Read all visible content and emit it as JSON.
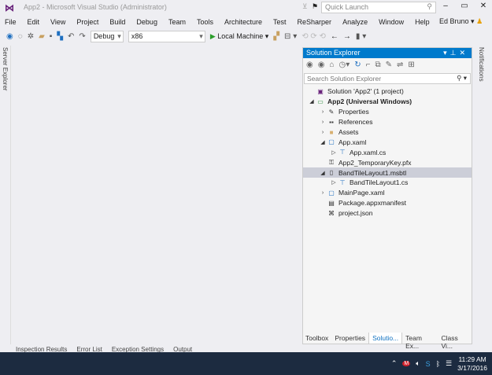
{
  "window": {
    "title": "App2 - Microsoft Visual Studio (Administrator)",
    "quick_launch_placeholder": "Quick Launch",
    "user": "Ed Bruno"
  },
  "menu": [
    "File",
    "Edit",
    "View",
    "Project",
    "Build",
    "Debug",
    "Team",
    "Tools",
    "Architecture",
    "Test",
    "ReSharper",
    "Analyze",
    "Window",
    "Help"
  ],
  "toolbar": {
    "configuration": "Debug",
    "platform": "x86",
    "run_target": "Local Machine"
  },
  "left_strip": {
    "label": "Server Explorer"
  },
  "right_strip": {
    "label": "Notifications"
  },
  "solution_explorer": {
    "title": "Solution Explorer",
    "search_placeholder": "Search Solution Explorer",
    "items": [
      {
        "label": "Solution 'App2' (1 project)",
        "indent": 0,
        "arrow": "",
        "icon": "solution-icon"
      },
      {
        "label": "App2 (Universal Windows)",
        "indent": 0,
        "arrow": "◢",
        "icon": "project-icon",
        "bold": true
      },
      {
        "label": "Properties",
        "indent": 1,
        "arrow": "›",
        "icon": "wrench-icon"
      },
      {
        "label": "References",
        "indent": 1,
        "arrow": "›",
        "icon": "references-icon"
      },
      {
        "label": "Assets",
        "indent": 1,
        "arrow": "›",
        "icon": "folder-icon"
      },
      {
        "label": "App.xaml",
        "indent": 1,
        "arrow": "◢",
        "icon": "xaml-icon"
      },
      {
        "label": "App.xaml.cs",
        "indent": 2,
        "arrow": "▷",
        "icon": "cs-icon"
      },
      {
        "label": "App2_TemporaryKey.pfx",
        "indent": 1,
        "arrow": "",
        "icon": "key-icon"
      },
      {
        "label": "BandTileLayout1.msbtl",
        "indent": 1,
        "arrow": "◢",
        "icon": "file-icon",
        "selected": true
      },
      {
        "label": "BandTileLayout1.cs",
        "indent": 2,
        "arrow": "▷",
        "icon": "cs-icon"
      },
      {
        "label": "MainPage.xaml",
        "indent": 1,
        "arrow": "›",
        "icon": "xaml-icon"
      },
      {
        "label": "Package.appxmanifest",
        "indent": 1,
        "arrow": "",
        "icon": "manifest-icon"
      },
      {
        "label": "project.json",
        "indent": 1,
        "arrow": "",
        "icon": "json-icon"
      }
    ],
    "bottom_tabs": [
      "Toolbox",
      "Properties",
      "Solutio...",
      "Team Ex...",
      "Class Vi..."
    ],
    "active_tab": "Solutio..."
  },
  "bottom_panel_tabs": [
    "Inspection Results",
    "Error List",
    "Exception Settings",
    "Output"
  ],
  "taskbar": {
    "time": "11:29 AM",
    "date": "3/17/2016"
  },
  "colors": {
    "accent": "#007acc",
    "taskbar": "#1c2b40",
    "selection": "#ccced8"
  }
}
